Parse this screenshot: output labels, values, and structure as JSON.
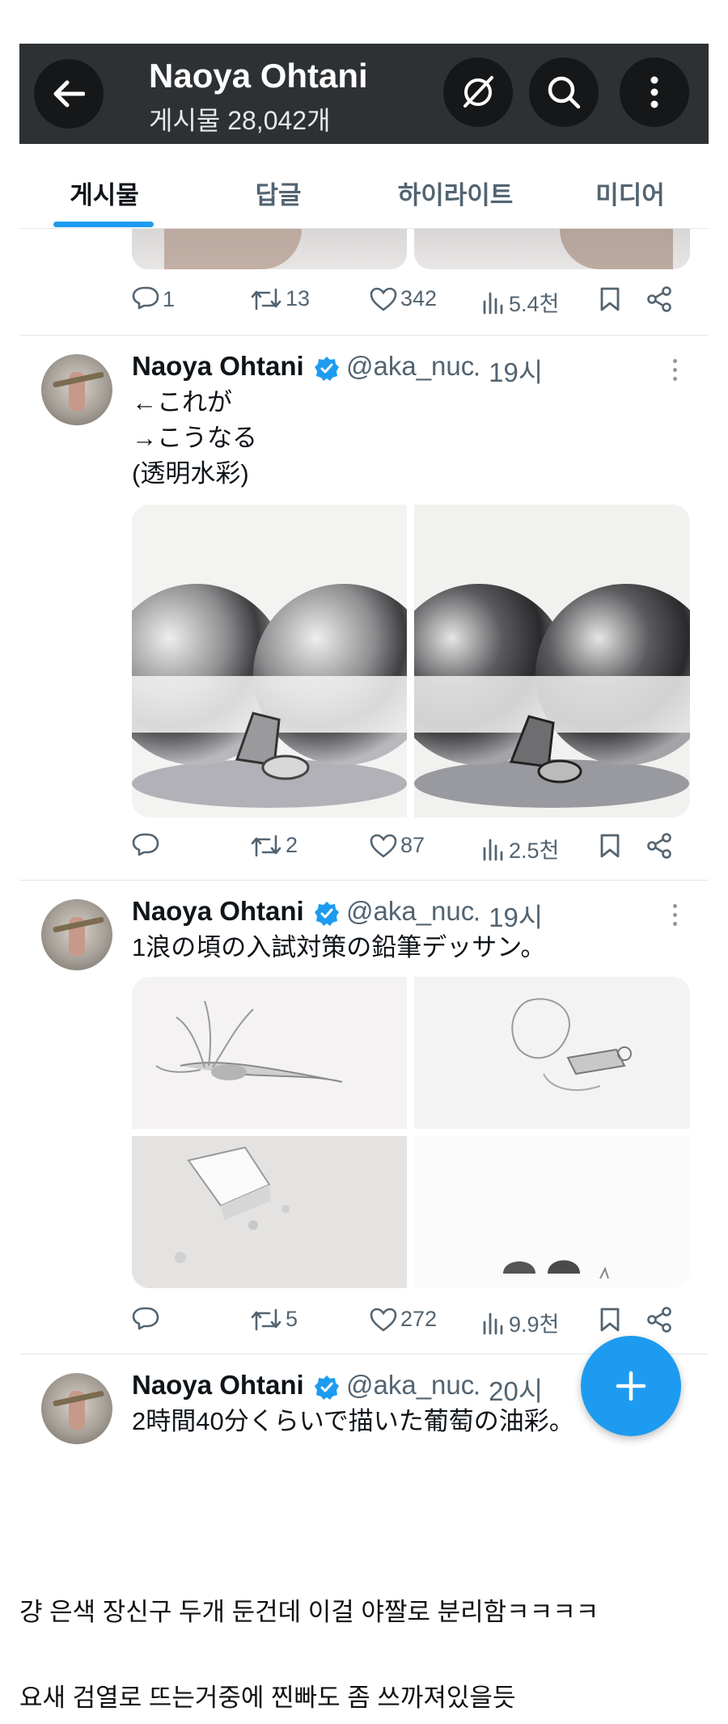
{
  "header": {
    "title": "Naoya Ohtani",
    "post_count": "게시물 28,042개"
  },
  "tabs": [
    {
      "label": "게시물",
      "active": true
    },
    {
      "label": "답글",
      "active": false
    },
    {
      "label": "하이라이트",
      "active": false
    },
    {
      "label": "미디어",
      "active": false
    }
  ],
  "posts": [
    {
      "partial": true,
      "replies": "1",
      "reposts": "13",
      "likes": "342",
      "views": "5.4천"
    },
    {
      "name": "Naoya Ohtani",
      "handle": "@aka_nuc",
      "time": "· 19시",
      "text": [
        "←これが",
        "→こうなる",
        "(透明水彩)"
      ],
      "replies": "",
      "reposts": "2",
      "likes": "87",
      "views": "2.5천",
      "media": [
        "watercolor-spheres-before",
        "watercolor-spheres-after"
      ]
    },
    {
      "name": "Naoya Ohtani",
      "handle": "@aka_nuc",
      "time": "· 19시",
      "text": [
        "1浪の頃の入試対策の鉛筆デッサン。"
      ],
      "replies": "",
      "reposts": "5",
      "likes": "272",
      "views": "9.9천",
      "media": [
        "pencil-squid",
        "pencil-shells",
        "pencil-tofu",
        "pencil-eggshells"
      ]
    },
    {
      "name": "Naoya Ohtani",
      "handle": "@aka_nuc",
      "time": "· 20시",
      "text": [
        "2時間40分くらいで描いた葡萄の油彩。"
      ]
    }
  ],
  "captions": [
    "걍 은색 장신구 두개 둔건데 이걸 야짤로 분리함ㅋㅋㅋㅋ",
    "요새 검열로 뜨는거중에 찐빠도 좀 쓰까져있을듯"
  ],
  "colors": {
    "accent": "#1d9bf0",
    "header_bg": "#2e3134",
    "text_secondary": "#536471"
  },
  "icons": [
    "back-arrow-icon",
    "grok-icon",
    "search-icon",
    "more-vertical-icon",
    "reply-icon",
    "repost-icon",
    "like-icon",
    "views-icon",
    "bookmark-icon",
    "share-icon",
    "verified-icon",
    "compose-plus-icon"
  ]
}
